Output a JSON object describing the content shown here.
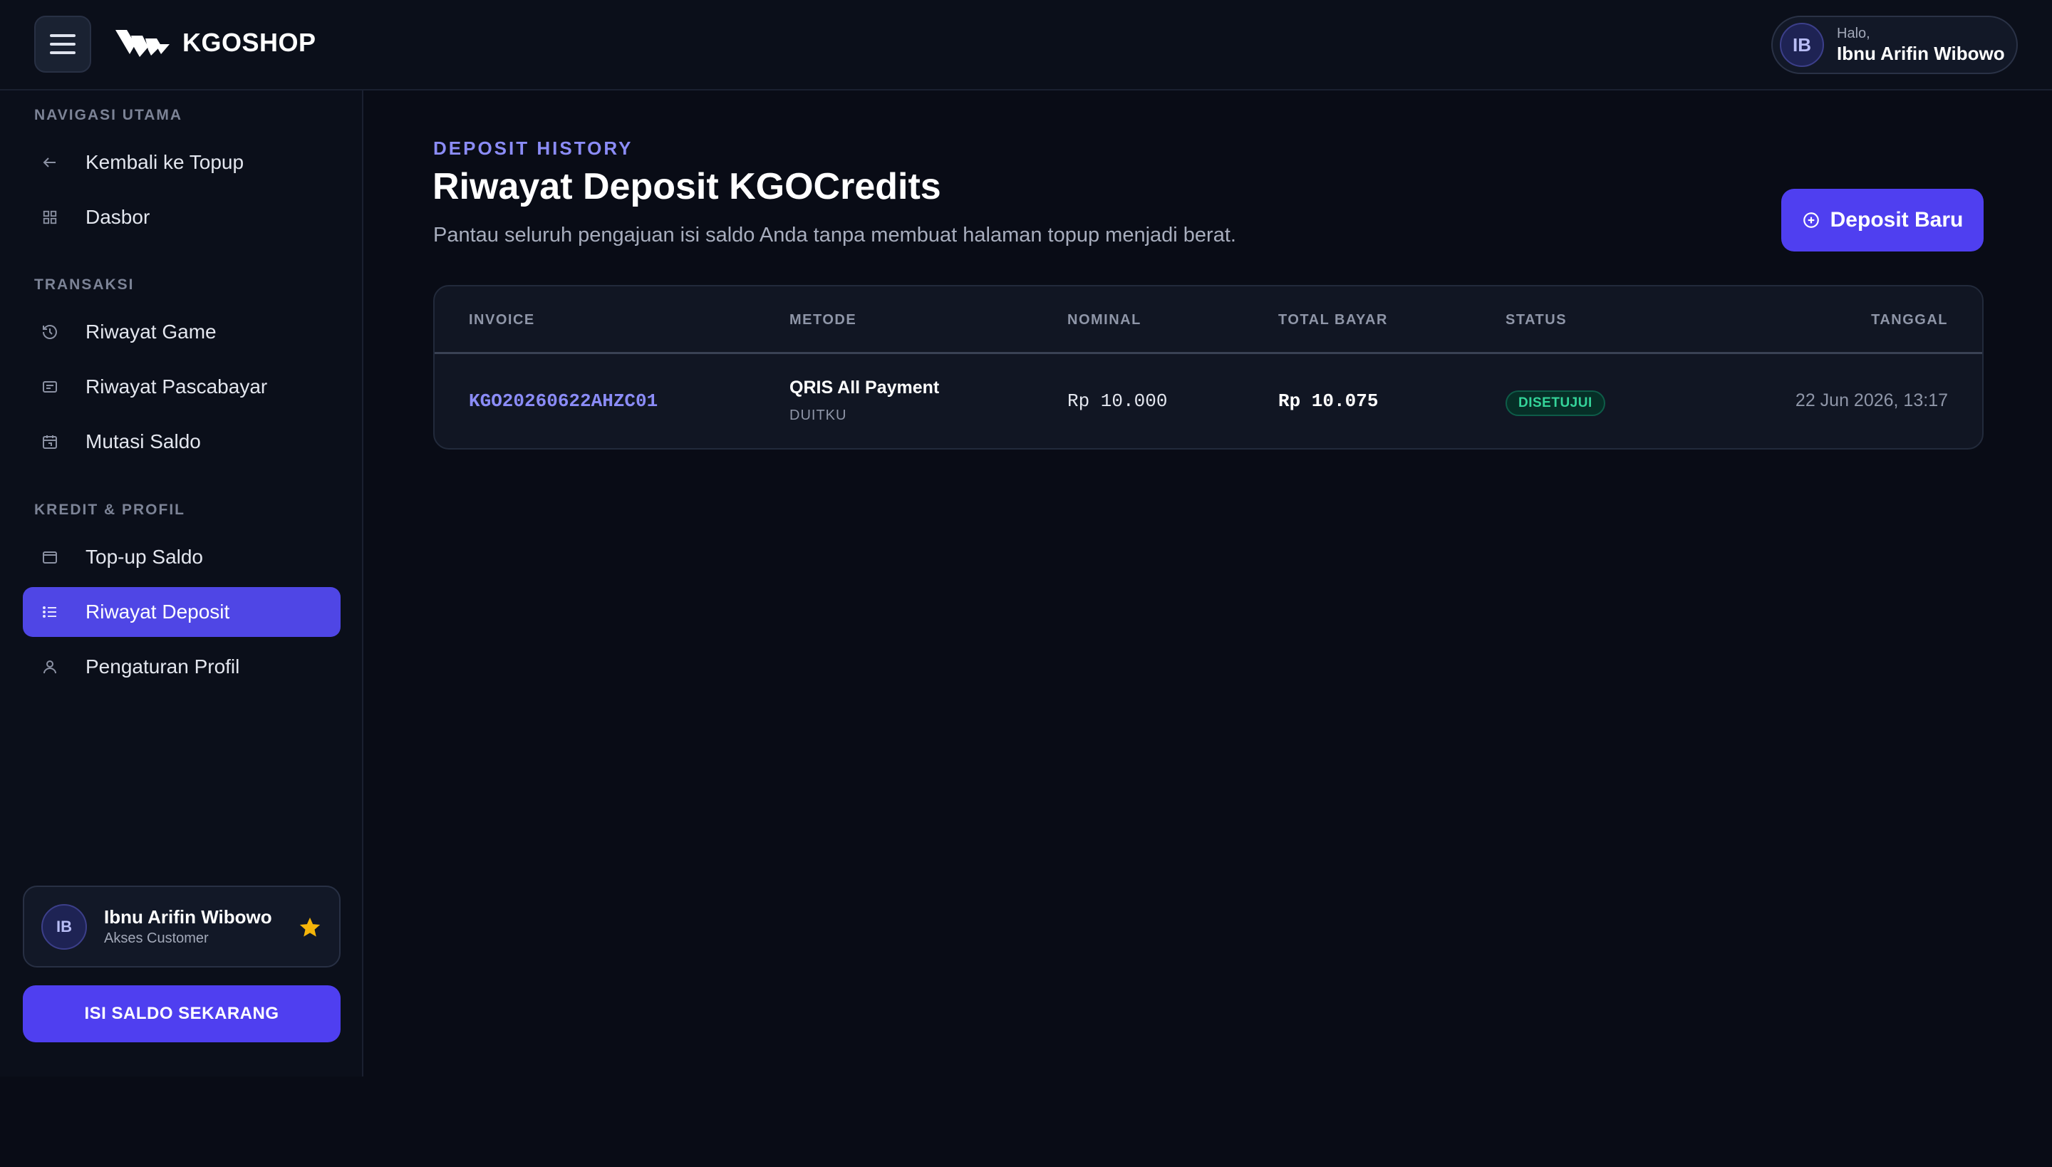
{
  "header": {
    "brand": "KGOSHOP",
    "greeting": "Halo,",
    "user_name": "Ibnu Arifin Wibowo",
    "avatar_initials": "IB"
  },
  "sidebar": {
    "sections": [
      {
        "label": "NAVIGASI UTAMA"
      },
      {
        "label": "TRANSAKSI"
      },
      {
        "label": "KREDIT & PROFIL"
      }
    ],
    "items": [
      {
        "label": "Kembali ke Topup",
        "icon": "arrow-left-icon"
      },
      {
        "label": "Dasbor",
        "icon": "grid-icon"
      },
      {
        "label": "Riwayat Game",
        "icon": "history-icon"
      },
      {
        "label": "Riwayat Pascabayar",
        "icon": "receipt-icon"
      },
      {
        "label": "Mutasi Saldo",
        "icon": "calendar-icon"
      },
      {
        "label": "Top-up Saldo",
        "icon": "wallet-icon"
      },
      {
        "label": "Riwayat Deposit",
        "icon": "list-icon",
        "active": true
      },
      {
        "label": "Pengaturan Profil",
        "icon": "user-icon"
      }
    ],
    "profile": {
      "initials": "IB",
      "name": "Ibnu Arifin Wibowo",
      "role": "Akses Customer"
    },
    "cta": "ISI SALDO SEKARANG"
  },
  "main": {
    "eyebrow": "DEPOSIT HISTORY",
    "title": "Riwayat Deposit KGOCredits",
    "subtitle": "Pantau seluruh pengajuan isi saldo Anda tanpa membuat halaman topup menjadi berat.",
    "new_deposit_label": "Deposit Baru",
    "table": {
      "columns": [
        "INVOICE",
        "METODE",
        "NOMINAL",
        "TOTAL BAYAR",
        "STATUS",
        "TANGGAL"
      ],
      "rows": [
        {
          "invoice": "KGO20260622AHZC01",
          "method": "QRIS All Payment",
          "method_provider": "DUITKU",
          "nominal": "Rp 10.000",
          "total": "Rp 10.075",
          "status": "DISETUJUI",
          "date": "22 Jun 2026, 13:17"
        }
      ]
    }
  },
  "colors": {
    "accent": "#4f46e5",
    "background": "#090c16",
    "status_success": "#34d399",
    "star": "#f5b50a"
  }
}
